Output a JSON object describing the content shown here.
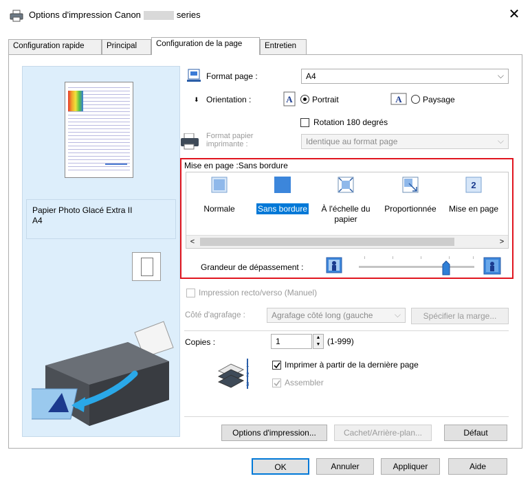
{
  "window": {
    "title_prefix": "Options d'impression Canon",
    "title_suffix": "series",
    "close_symbol": "✕"
  },
  "tabs": [
    {
      "label": "Configuration rapide",
      "active": false
    },
    {
      "label": "Principal",
      "active": false
    },
    {
      "label": "Configuration de la page",
      "active": true
    },
    {
      "label": "Entretien",
      "active": false
    }
  ],
  "preview": {
    "media_line1": "Papier Photo Glacé Extra II",
    "media_line2": "A4"
  },
  "page_setup": {
    "page_size_label": "Format page :",
    "page_size_value": "A4",
    "orientation_label": "Orientation :",
    "portrait_label": "Portrait",
    "portrait_selected": true,
    "landscape_label": "Paysage",
    "landscape_selected": false,
    "rotate_label": "Rotation 180 degrés",
    "rotate_checked": false,
    "printer_paper_label_1": "Format papier",
    "printer_paper_label_2": "imprimante :",
    "printer_paper_value": "Identique au format page"
  },
  "layout": {
    "header": "Mise en page :Sans bordure",
    "items": [
      {
        "label": "Normale",
        "label2": "",
        "selected": false,
        "icon": "normal-layout-icon"
      },
      {
        "label": "Sans bordure",
        "label2": "",
        "selected": true,
        "icon": "borderless-layout-icon"
      },
      {
        "label": "À l'échelle du",
        "label2": "papier",
        "selected": false,
        "icon": "fit-to-page-icon"
      },
      {
        "label": "Proportionnée",
        "label2": "",
        "selected": false,
        "icon": "scaled-icon"
      },
      {
        "label": "Mise en page",
        "label2": "",
        "selected": false,
        "icon": "page-layout-2up-icon"
      }
    ],
    "page_layout_glyph": "2",
    "scroll_left": "<",
    "scroll_right": ">",
    "extension_label": "Grandeur de dépassement :",
    "extension_level_fraction": 0.75
  },
  "duplex": {
    "label": "Impression recto/verso (Manuel)",
    "checked": false,
    "stapling_label": "Côté d'agrafage :",
    "stapling_value": "Agrafage côté long (gauche",
    "margin_button": "Spécifier la marge..."
  },
  "copies": {
    "label": "Copies :",
    "value": "1",
    "range": "(1-999)",
    "last_page_label": "Imprimer à partir de la dernière page",
    "last_page_checked": true,
    "collate_label": "Assembler",
    "collate_checked": true
  },
  "panel_buttons": {
    "print_options": "Options d'impression...",
    "stamp_bg": "Cachet/Arrière-plan...",
    "defaults": "Défaut"
  },
  "dialog_buttons": {
    "ok": "OK",
    "cancel": "Annuler",
    "apply": "Appliquer",
    "help": "Aide"
  },
  "colors": {
    "accent": "#0078d7",
    "highlight_frame": "#e0141e",
    "preview_bg": "#ddeefb"
  }
}
